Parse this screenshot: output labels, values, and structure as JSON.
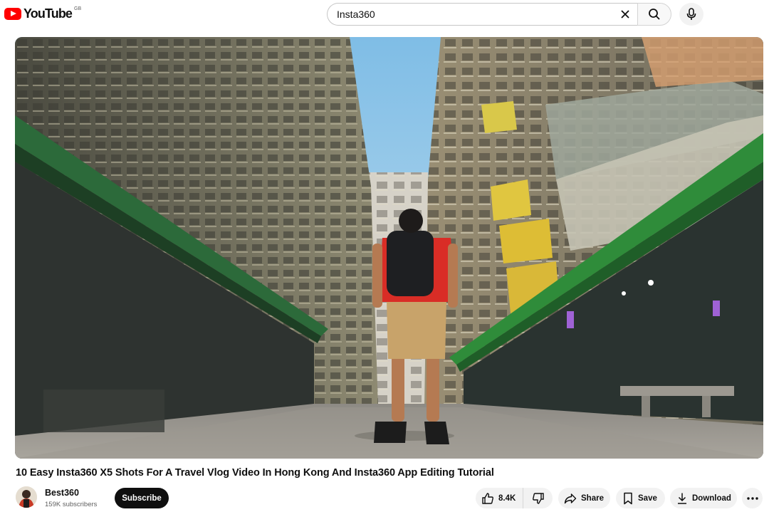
{
  "header": {
    "logo_text": "YouTube",
    "country_code": "GB",
    "search": {
      "value": "Insta360"
    }
  },
  "video": {
    "title": "10 Easy Insta360 X5 Shots For A Travel Vlog Video In Hong Kong And Insta360 App Editing Tutorial"
  },
  "channel": {
    "name": "Best360",
    "subscribers": "159K subscribers",
    "subscribe_label": "Subscribe"
  },
  "actions": {
    "likes": "8.4K",
    "share": "Share",
    "save": "Save",
    "download": "Download"
  },
  "icons": {
    "logo": "youtube-logo-icon",
    "clear": "close-icon",
    "search": "search-icon",
    "mic": "microphone-icon",
    "like": "thumbs-up-icon",
    "dislike": "thumbs-down-icon",
    "share": "share-arrow-icon",
    "save": "bookmark-icon",
    "download": "download-icon",
    "more": "more-horizontal-icon"
  },
  "colors": {
    "brand": "#ff0000",
    "subscribe_bg": "#0f0f0f",
    "pill_bg": "#f2f2f2"
  }
}
